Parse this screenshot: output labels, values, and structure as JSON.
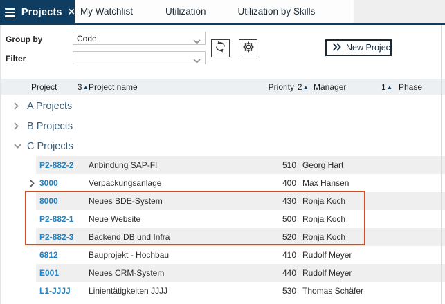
{
  "colors": {
    "navy": "#0e3d61",
    "code_blue": "#1f83c5",
    "group_text": "#3d5d77",
    "highlight_border": "#cf4e25",
    "row_alt": "#efefef",
    "header_bg": "#edf0f2"
  },
  "icons": {
    "sort_asc_glyph": "▲",
    "close_glyph": "×"
  },
  "window": {
    "active_tab": "Projects",
    "tabs": [
      "My Watchlist",
      "Utilization",
      "Utilization by Skills"
    ]
  },
  "toolbar": {
    "group_by_label": "Group by",
    "group_by_value": "Code",
    "filter_label": "Filter",
    "filter_value": "",
    "new_project_label": "New Project"
  },
  "table": {
    "headers": [
      {
        "label": "Project",
        "sort_order": "3"
      },
      {
        "label": "Project name",
        "sort_order": ""
      },
      {
        "label": "Priority",
        "sort_order": "2"
      },
      {
        "label": "Manager",
        "sort_order": "1"
      },
      {
        "label": "Phase",
        "sort_order": ""
      }
    ],
    "groups": [
      {
        "label": "A Projects",
        "expanded": false,
        "rows": []
      },
      {
        "label": "B Projects",
        "expanded": false,
        "rows": []
      },
      {
        "label": "C Projects",
        "expanded": true,
        "rows": [
          {
            "code": "P2-882-2",
            "name": "Anbindung SAP-FI",
            "priority": "510",
            "manager": "Georg Hart",
            "phase": "",
            "expandable": false,
            "highlighted": false
          },
          {
            "code": "3000",
            "name": "Verpackungsanlage",
            "priority": "400",
            "manager": "Max Hansen",
            "phase": "",
            "expandable": true,
            "highlighted": false
          },
          {
            "code": "8000",
            "name": "Neues BDE-System",
            "priority": "430",
            "manager": "Ronja Koch",
            "phase": "",
            "expandable": false,
            "highlighted": true
          },
          {
            "code": "P2-882-1",
            "name": "Neue Website",
            "priority": "500",
            "manager": "Ronja Koch",
            "phase": "",
            "expandable": false,
            "highlighted": true
          },
          {
            "code": "P2-882-3",
            "name": "Backend DB und Infra",
            "priority": "520",
            "manager": "Ronja Koch",
            "phase": "",
            "expandable": false,
            "highlighted": true
          },
          {
            "code": "6812",
            "name": "Bauprojekt - Hochbau",
            "priority": "410",
            "manager": "Rudolf Meyer",
            "phase": "",
            "expandable": false,
            "highlighted": false
          },
          {
            "code": "E001",
            "name": "Neues CRM-System",
            "priority": "440",
            "manager": "Rudolf Meyer",
            "phase": "",
            "expandable": false,
            "highlighted": false
          },
          {
            "code": "L1-JJJJ",
            "name": "Linientätigkeiten JJJJ",
            "priority": "530",
            "manager": "Thomas Schäfer",
            "phase": "",
            "expandable": false,
            "highlighted": false
          }
        ]
      }
    ]
  }
}
